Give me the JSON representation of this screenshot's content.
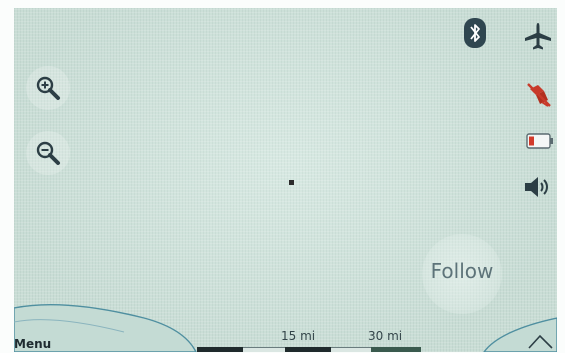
{
  "map": {
    "zoom_in_icon": "zoom-in-magnifier-icon",
    "zoom_out_icon": "zoom-out-magnifier-icon",
    "follow_label": "Follow",
    "menu_label": "Menu",
    "scale": {
      "label_1": "15 mi",
      "label_2": "30 mi"
    },
    "colors": {
      "map_background": "#cfe4dc",
      "icon_dark": "#2c3e45",
      "gps_off_red": "#c83a2a",
      "battery_red": "#d23b2b"
    }
  },
  "status_icons": {
    "bluetooth": "bluetooth-icon",
    "airplane": "airplane-icon",
    "gps": "gps-off-icon",
    "battery": "battery-low-icon",
    "volume": "volume-icon"
  }
}
